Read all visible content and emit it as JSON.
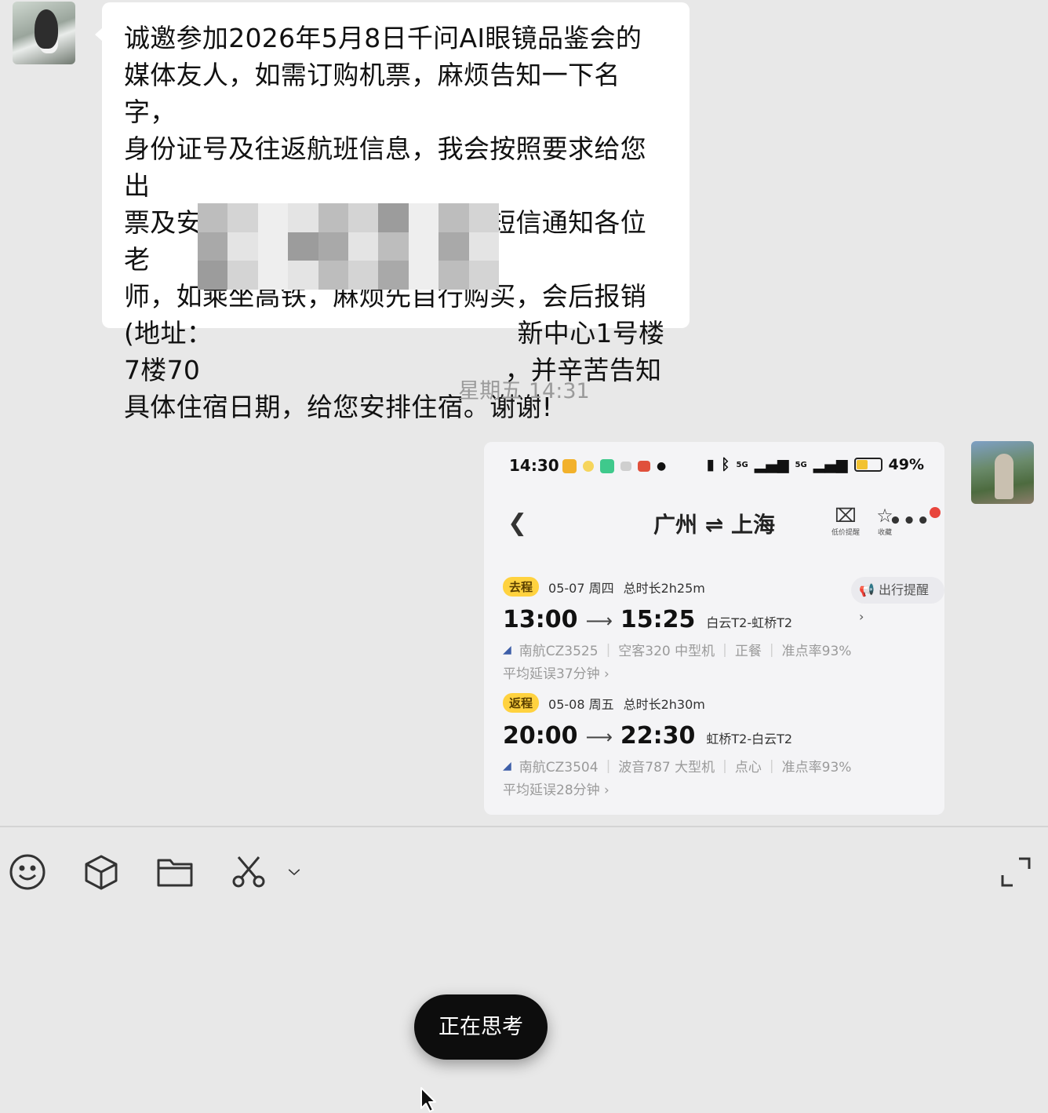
{
  "incoming_message": {
    "text": "诚邀参加2026年5月8日千问AI眼镜品鉴会的\n媒体友人，如需订购机票，麻烦告知一下名字，\n身份证号及往返航班信息，我会按照要求给您出\n票及安排相关住宿，机票出票后短信通知各位老\n师，如乘坐高铁，麻烦先自行购买，会后报销\n(地址：                                    新中心1号楼\n7楼70                                    ，并辛苦告知\n具体住宿日期，给您安排住宿。谢谢!"
  },
  "timestamp": "星期五 14:31",
  "screenshot": {
    "status_bar": {
      "time": "14:30",
      "network_5g_1": "5G",
      "network_5g_2": "5G",
      "battery": "49%"
    },
    "route_title": "广州 ⇌ 上海",
    "tools": [
      {
        "icon": "price-alert-icon",
        "label": "低价提醒"
      },
      {
        "icon": "star-icon",
        "label": "收藏"
      }
    ],
    "travel_reminder": "出行提醒 ›",
    "legs": [
      {
        "tag": "去程",
        "date": "05-07 周四",
        "duration": "总时长2h25m",
        "depart": "13:00",
        "arrive": "15:25",
        "airports": "白云T2-虹桥T2",
        "flight": "南航CZ3525",
        "aircraft": "空客320 中型机",
        "meal": "正餐",
        "on_time": "准点率93%",
        "delay": "平均延误37分钟 ›"
      },
      {
        "tag": "返程",
        "date": "05-08 周五",
        "duration": "总时长2h30m",
        "depart": "20:00",
        "arrive": "22:30",
        "airports": "虹桥T2-白云T2",
        "flight": "南航CZ3504",
        "aircraft": "波音787 大型机",
        "meal": "点心",
        "on_time": "准点率93%",
        "delay": "平均延误28分钟 ›"
      }
    ]
  },
  "toolbar": {
    "icons": [
      "emoji-icon",
      "cube-icon",
      "folder-icon",
      "scissors-icon",
      "chevron-down-icon",
      "expand-icon"
    ]
  },
  "thinking_button": {
    "label": "正在思考"
  }
}
